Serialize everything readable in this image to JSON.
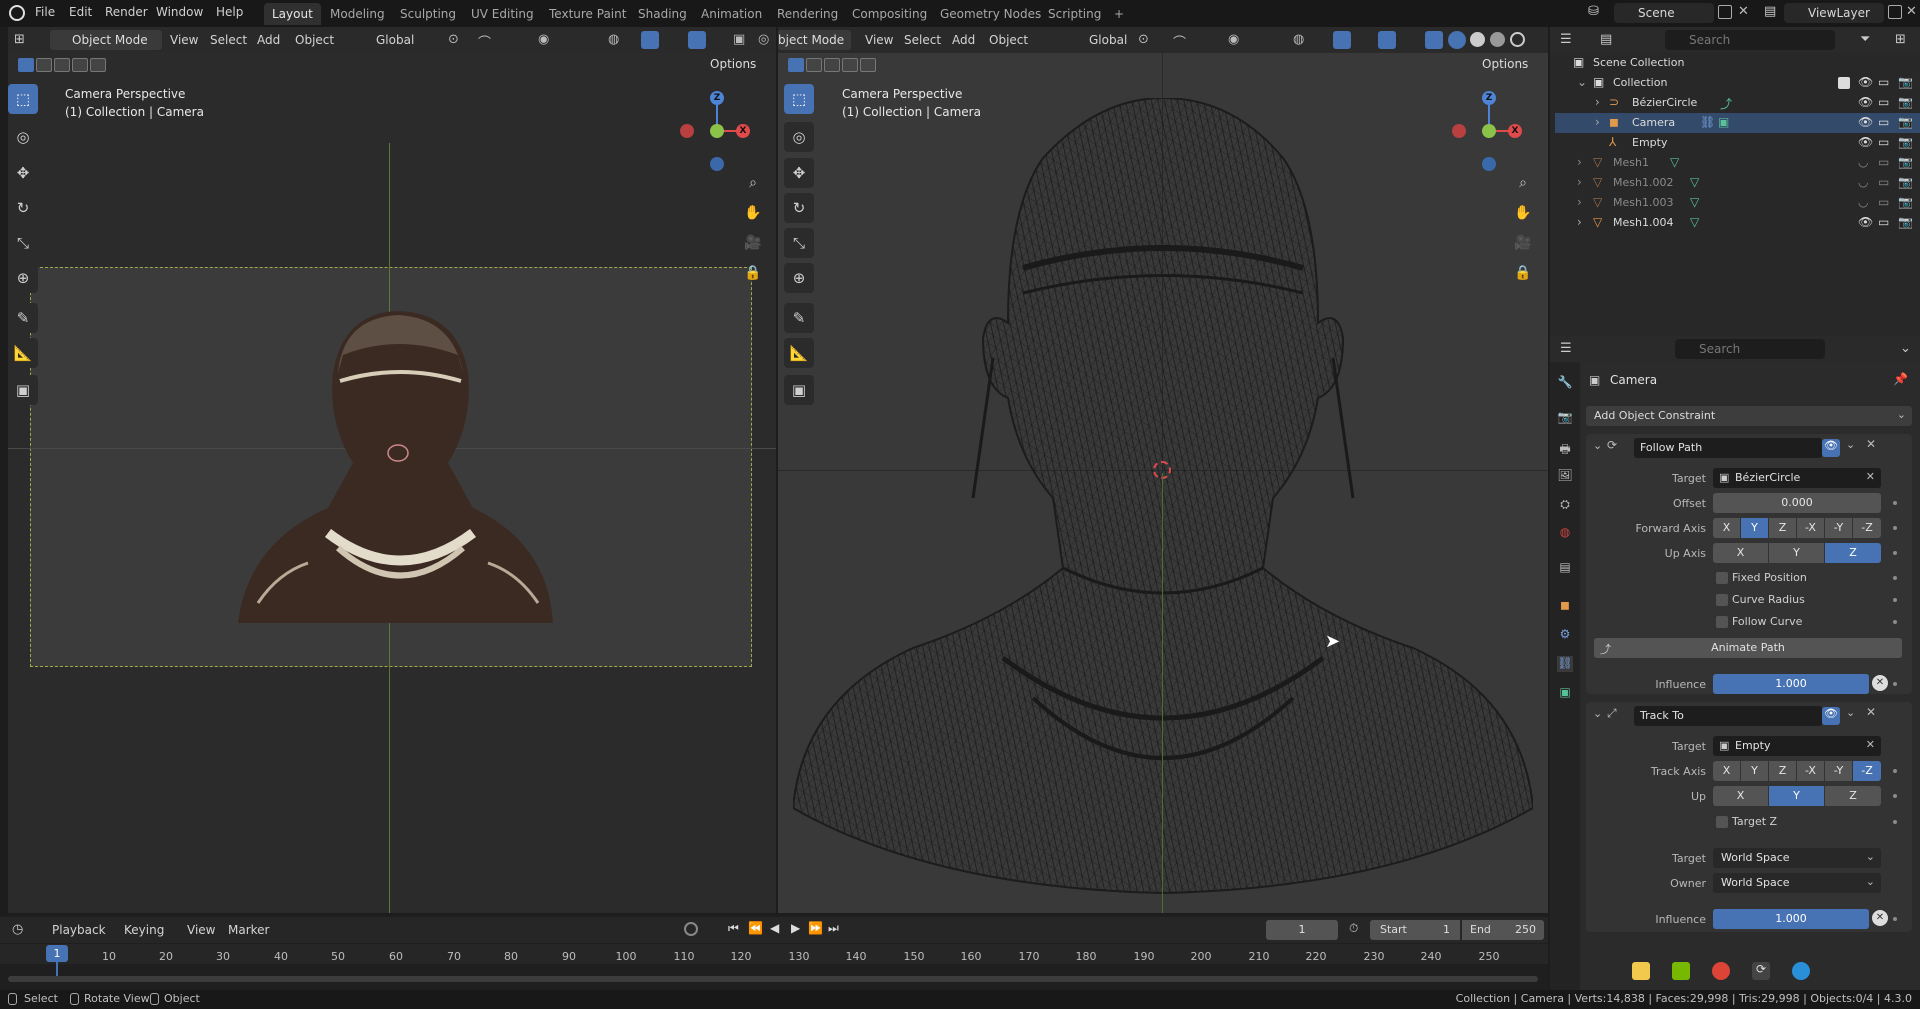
{
  "menubar": {
    "menus": [
      "File",
      "Edit",
      "Render",
      "Window",
      "Help"
    ],
    "workspaces": [
      "Layout",
      "Modeling",
      "Sculpting",
      "UV Editing",
      "Texture Paint",
      "Shading",
      "Animation",
      "Rendering",
      "Compositing",
      "Geometry Nodes",
      "Scripting"
    ],
    "active_workspace": "Layout",
    "add_tab": "+",
    "scene": "Scene",
    "view_layer": "ViewLayer"
  },
  "left_viewport": {
    "mode": "Object Mode",
    "menus": [
      "View",
      "Select",
      "Add",
      "Object"
    ],
    "transform_orientation": "Global",
    "options": "Options",
    "title": "Camera Perspective",
    "subtitle": "(1) Collection | Camera",
    "gizmo": {
      "z": "Z",
      "x": "X"
    }
  },
  "right_viewport": {
    "mode": "Object Mode",
    "mode_visible": "bject Mode",
    "menus": [
      "View",
      "Select",
      "Add",
      "Object"
    ],
    "transform_orientation": "Global",
    "options": "Options",
    "title": "Camera Perspective",
    "subtitle": "(1) Collection | Camera",
    "gizmo": {
      "z": "Z",
      "x": "X"
    }
  },
  "outliner": {
    "search_placeholder": "Search",
    "scene_collection": "Scene Collection",
    "collection": "Collection",
    "items": [
      {
        "name": "BézierCircle",
        "visible": true
      },
      {
        "name": "Camera",
        "visible": true
      },
      {
        "name": "Empty",
        "visible": true
      },
      {
        "name": "Mesh1",
        "visible": false
      },
      {
        "name": "Mesh1.002",
        "visible": false
      },
      {
        "name": "Mesh1.003",
        "visible": false
      },
      {
        "name": "Mesh1.004",
        "visible": true
      }
    ]
  },
  "properties": {
    "search_placeholder": "Search",
    "object_name": "Camera",
    "add_constraint": "Add Object Constraint",
    "follow_path": {
      "name": "Follow Path",
      "target_label": "Target",
      "target": "BézierCircle",
      "offset_label": "Offset",
      "offset": "0.000",
      "forward_axis_label": "Forward Axis",
      "forward_axes": [
        "X",
        "Y",
        "Z",
        "-X",
        "-Y",
        "-Z"
      ],
      "forward_selected": "Y",
      "up_axis_label": "Up Axis",
      "up_axes": [
        "X",
        "Y",
        "Z"
      ],
      "up_selected": "Z",
      "fixed_position": "Fixed Position",
      "curve_radius": "Curve Radius",
      "follow_curve": "Follow Curve",
      "animate_path": "Animate Path",
      "influence_label": "Influence",
      "influence": "1.000",
      "influence_fraction": 1.0
    },
    "track_to": {
      "name": "Track To",
      "target_label": "Target",
      "target": "Empty",
      "track_axis_label": "Track Axis",
      "track_axes": [
        "X",
        "Y",
        "Z",
        "-X",
        "-Y",
        "-Z"
      ],
      "track_selected": "-Z",
      "up_label": "Up",
      "up_axes": [
        "X",
        "Y",
        "Z"
      ],
      "up_selected": "Y",
      "target_z": "Target Z",
      "target_space_label": "Target",
      "target_space": "World Space",
      "owner_space_label": "Owner",
      "owner_space": "World Space",
      "influence_label": "Influence",
      "influence": "1.000",
      "influence_fraction": 1.0
    }
  },
  "timeline": {
    "menus": [
      "Playback",
      "Keying",
      "View",
      "Marker"
    ],
    "current_frame": "1",
    "start_label": "Start",
    "start": "1",
    "end_label": "End",
    "end": "250",
    "ruler": [
      "10",
      "20",
      "30",
      "40",
      "50",
      "60",
      "70",
      "80",
      "90",
      "100",
      "110",
      "120",
      "130",
      "140",
      "150",
      "160",
      "170",
      "180",
      "190",
      "200",
      "210",
      "220",
      "230",
      "240",
      "250"
    ],
    "playhead": "1"
  },
  "statusbar": {
    "select": "Select",
    "rotate_view": "Rotate View",
    "object": "Object",
    "stats": "Collection | Camera | Verts:14,838 | Faces:29,998 | Tris:29,998 | Objects:0/4 | 4.3.0"
  },
  "colors": {
    "accent": "#4772b3",
    "x_axis": "#e04a4a",
    "y_axis": "#8bc24a",
    "z_axis": "#4d84d6",
    "bg": "#1d1d1d"
  }
}
